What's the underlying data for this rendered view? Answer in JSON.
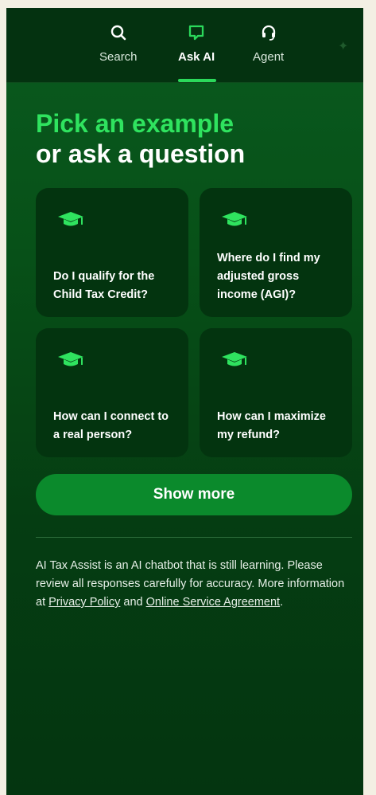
{
  "nav": {
    "tabs": [
      {
        "label": "Search",
        "icon": "search-icon"
      },
      {
        "label": "Ask AI",
        "icon": "chat-icon",
        "active": true
      },
      {
        "label": "Agent",
        "icon": "headset-icon"
      }
    ]
  },
  "heading": {
    "line1": "Pick an example",
    "line2": "or ask a question"
  },
  "examples": [
    {
      "question": "Do I qualify for the Child Tax Credit?",
      "icon": "graduation-cap-icon"
    },
    {
      "question": "Where do I find my adjusted gross income (AGI)?",
      "icon": "graduation-cap-icon"
    },
    {
      "question": "How can I connect to a real person?",
      "icon": "graduation-cap-icon"
    },
    {
      "question": "How can I maximize my refund?",
      "icon": "graduation-cap-icon"
    }
  ],
  "show_more_label": "Show more",
  "disclaimer": {
    "text": "AI Tax Assist is an AI chatbot that is still learning. Please review all responses carefully for accuracy. More information at",
    "link1": "Privacy Policy",
    "and": "and",
    "link2": "Online Service Agreement",
    "end": "."
  },
  "colors": {
    "accent": "#2fe35f",
    "background": "#075118",
    "card": "#03340f",
    "button": "#0b8a2c"
  }
}
